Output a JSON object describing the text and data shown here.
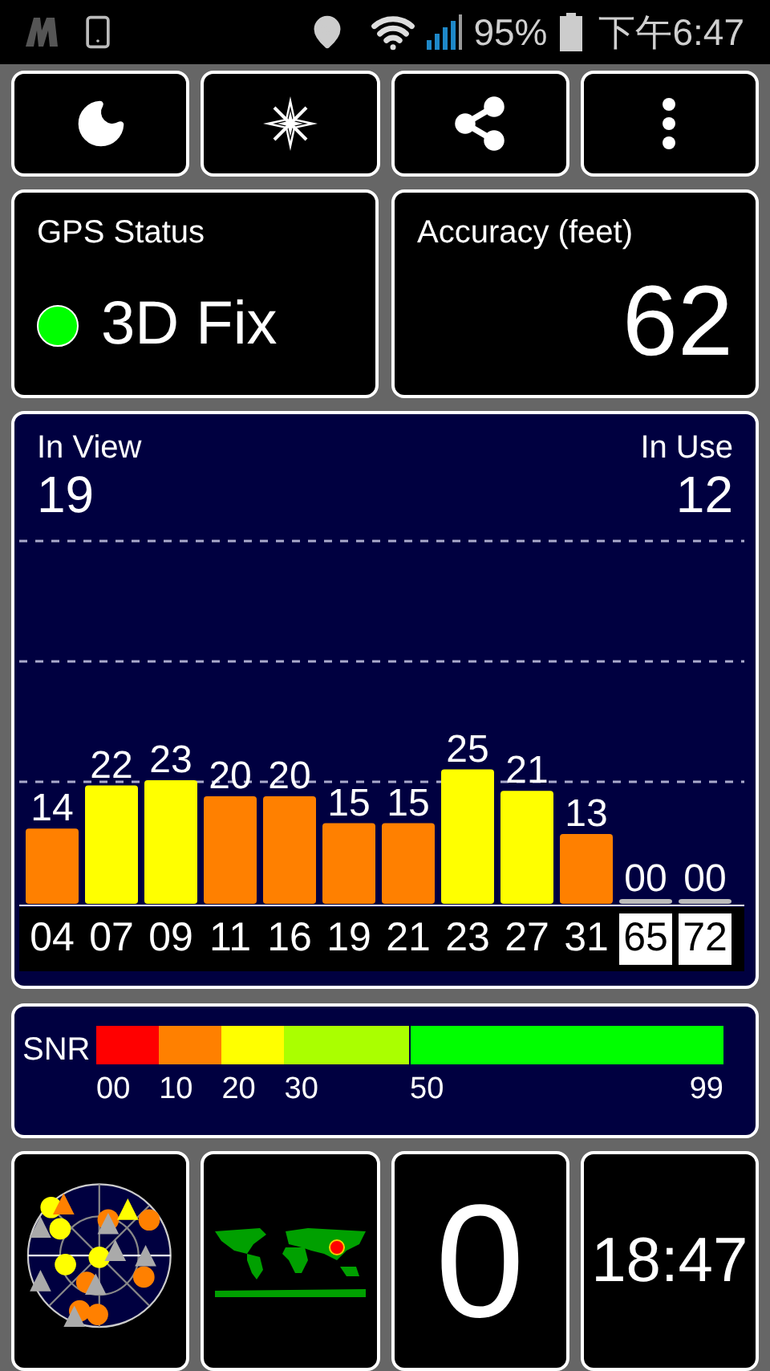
{
  "status_bar": {
    "battery": "95%",
    "time": "下午6:47"
  },
  "toolbar": {
    "buttons": [
      {
        "kind": "moon"
      },
      {
        "kind": "compass"
      },
      {
        "kind": "share"
      },
      {
        "kind": "more"
      }
    ]
  },
  "gps_status": {
    "label": "GPS Status",
    "value": "3D Fix",
    "color": "#00ff00"
  },
  "accuracy": {
    "label": "Accuracy (feet)",
    "value": "62"
  },
  "sky": {
    "in_view_label": "In View",
    "in_view": "19",
    "in_use_label": "In Use",
    "in_use": "12",
    "chart_data": {
      "type": "bar",
      "categories": [
        "04",
        "07",
        "09",
        "11",
        "16",
        "19",
        "21",
        "23",
        "27",
        "31",
        "65",
        "72"
      ],
      "values": [
        14,
        22,
        23,
        20,
        20,
        15,
        15,
        25,
        21,
        13,
        0,
        0
      ],
      "value_labels": [
        "14",
        "22",
        "23",
        "20",
        "20",
        "15",
        "15",
        "25",
        "21",
        "13",
        "00",
        "00"
      ]
    },
    "boxed": [
      false,
      false,
      false,
      false,
      false,
      false,
      false,
      false,
      false,
      false,
      true,
      true
    ]
  },
  "snr_scale": {
    "label": "SNR",
    "ticks": [
      {
        "label": "00",
        "color": "#ff0000"
      },
      {
        "label": "10",
        "color": "#ff8000"
      },
      {
        "label": "20",
        "color": "#ffff00"
      },
      {
        "label": "30",
        "color": "#aaff00"
      },
      {
        "label": "50",
        "color": "#00ff00"
      },
      {
        "label": "99"
      }
    ]
  },
  "tiles": [
    {
      "kind": "skyplot"
    },
    {
      "kind": "worldmap"
    },
    {
      "kind": "text",
      "text": "0"
    },
    {
      "kind": "text",
      "text": "18:47"
    }
  ]
}
